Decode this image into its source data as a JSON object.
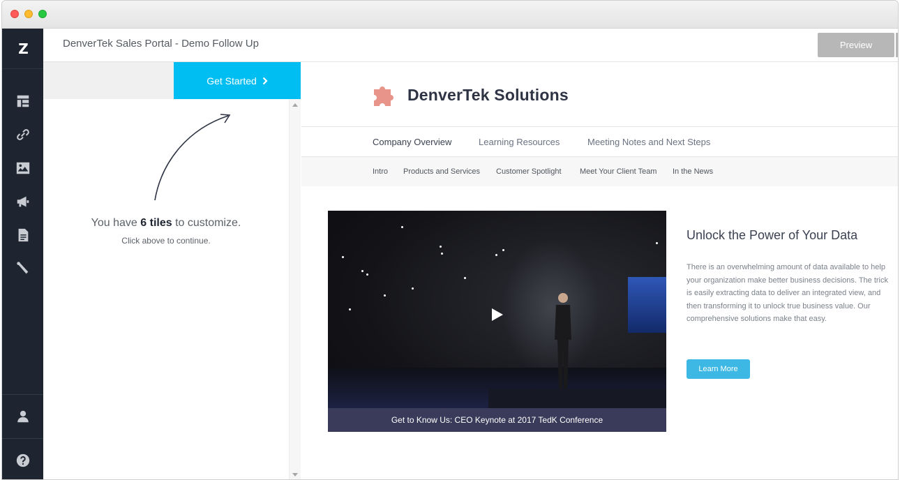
{
  "window": {
    "title": ""
  },
  "sidebar": {
    "logo": "Z",
    "items": [
      {
        "icon": "dashboard-icon"
      },
      {
        "icon": "link-icon"
      },
      {
        "icon": "image-icon"
      },
      {
        "icon": "megaphone-icon"
      },
      {
        "icon": "document-icon"
      },
      {
        "icon": "tools-icon"
      }
    ],
    "bottom_items": [
      {
        "icon": "user-icon"
      },
      {
        "icon": "help-icon"
      }
    ],
    "colors": {
      "background": "#1e2530",
      "icon": "#c8ccd2"
    }
  },
  "header": {
    "title": "DenverTek Sales Portal - Demo Follow Up",
    "preview_label": "Preview"
  },
  "left_panel": {
    "get_started_label": "Get Started",
    "tiles_prefix": "You have ",
    "tiles_count": "6 tiles",
    "tiles_suffix": " to customize.",
    "click_message": "Click above to continue.",
    "accent_color": "#00bef2"
  },
  "preview": {
    "brand_name": "DenverTek Solutions",
    "brand_color": "#e8948a",
    "nav_primary": [
      "Company Overview",
      "Learning Resources",
      "Meeting Notes and Next Steps"
    ],
    "nav_secondary": [
      "Intro",
      "Products and Services",
      "Customer Spotlight",
      "Meet Your Client Team",
      "In the News"
    ],
    "video_caption": "Get to Know Us: CEO Keynote at 2017 TedK Conference",
    "headline": "Unlock the Power of Your Data",
    "body": "There is an overwhelming amount of data available to help your organization make better business decisions. The trick is easily extracting data to deliver an integrated view, and then transforming it to unlock true business value. Our comprehensive solutions make that easy.",
    "learn_more_label": "Learn More",
    "learn_more_color": "#3db8e4"
  }
}
